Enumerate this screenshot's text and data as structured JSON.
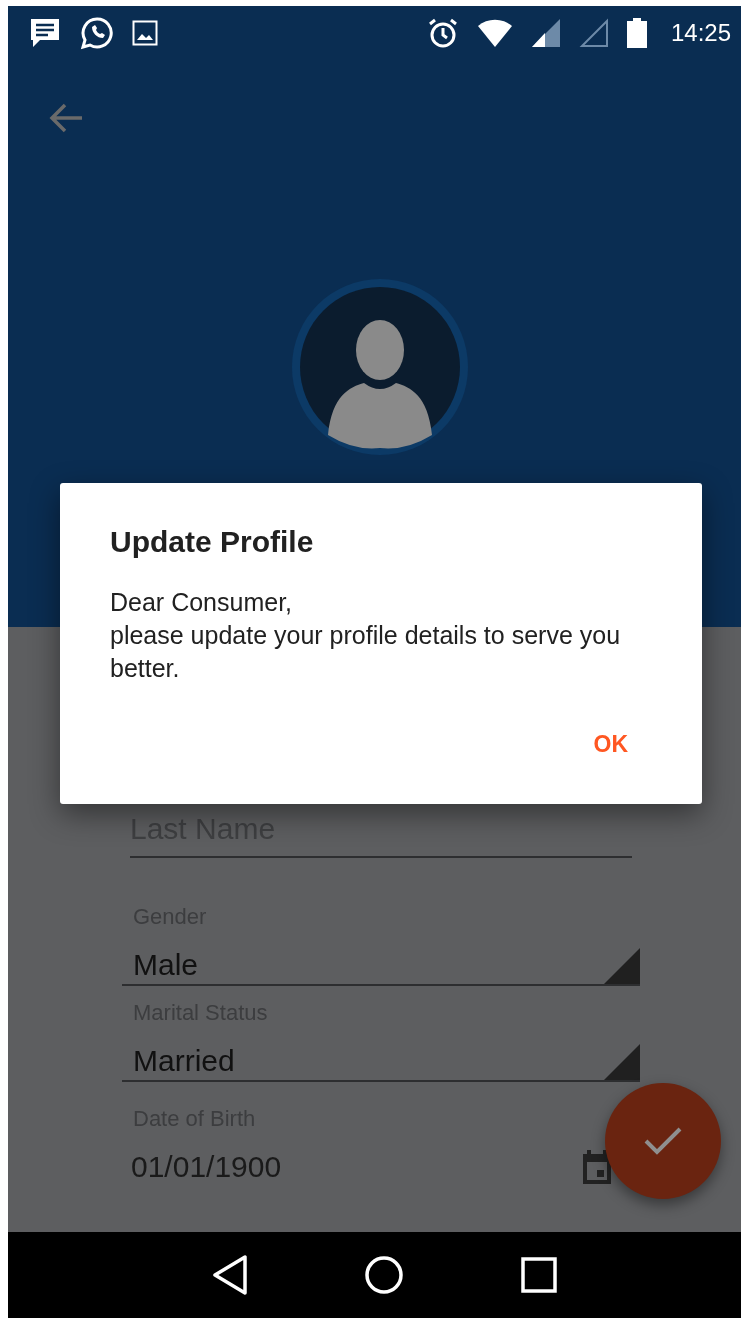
{
  "status_bar": {
    "time": "14:25"
  },
  "dialog": {
    "title": "Update Profile",
    "message": "Dear Consumer,\nplease update your profile details to serve you better.",
    "buttons": [
      "OK"
    ]
  },
  "form": {
    "fields": [
      {
        "kind": "text",
        "placeholder": "Last Name"
      },
      {
        "kind": "dropdown",
        "label": "Gender",
        "value": "Male"
      },
      {
        "kind": "dropdown",
        "label": "Marital Status",
        "value": "Married"
      },
      {
        "kind": "date",
        "label": "Date of Birth",
        "value": "01/01/1900"
      }
    ]
  }
}
